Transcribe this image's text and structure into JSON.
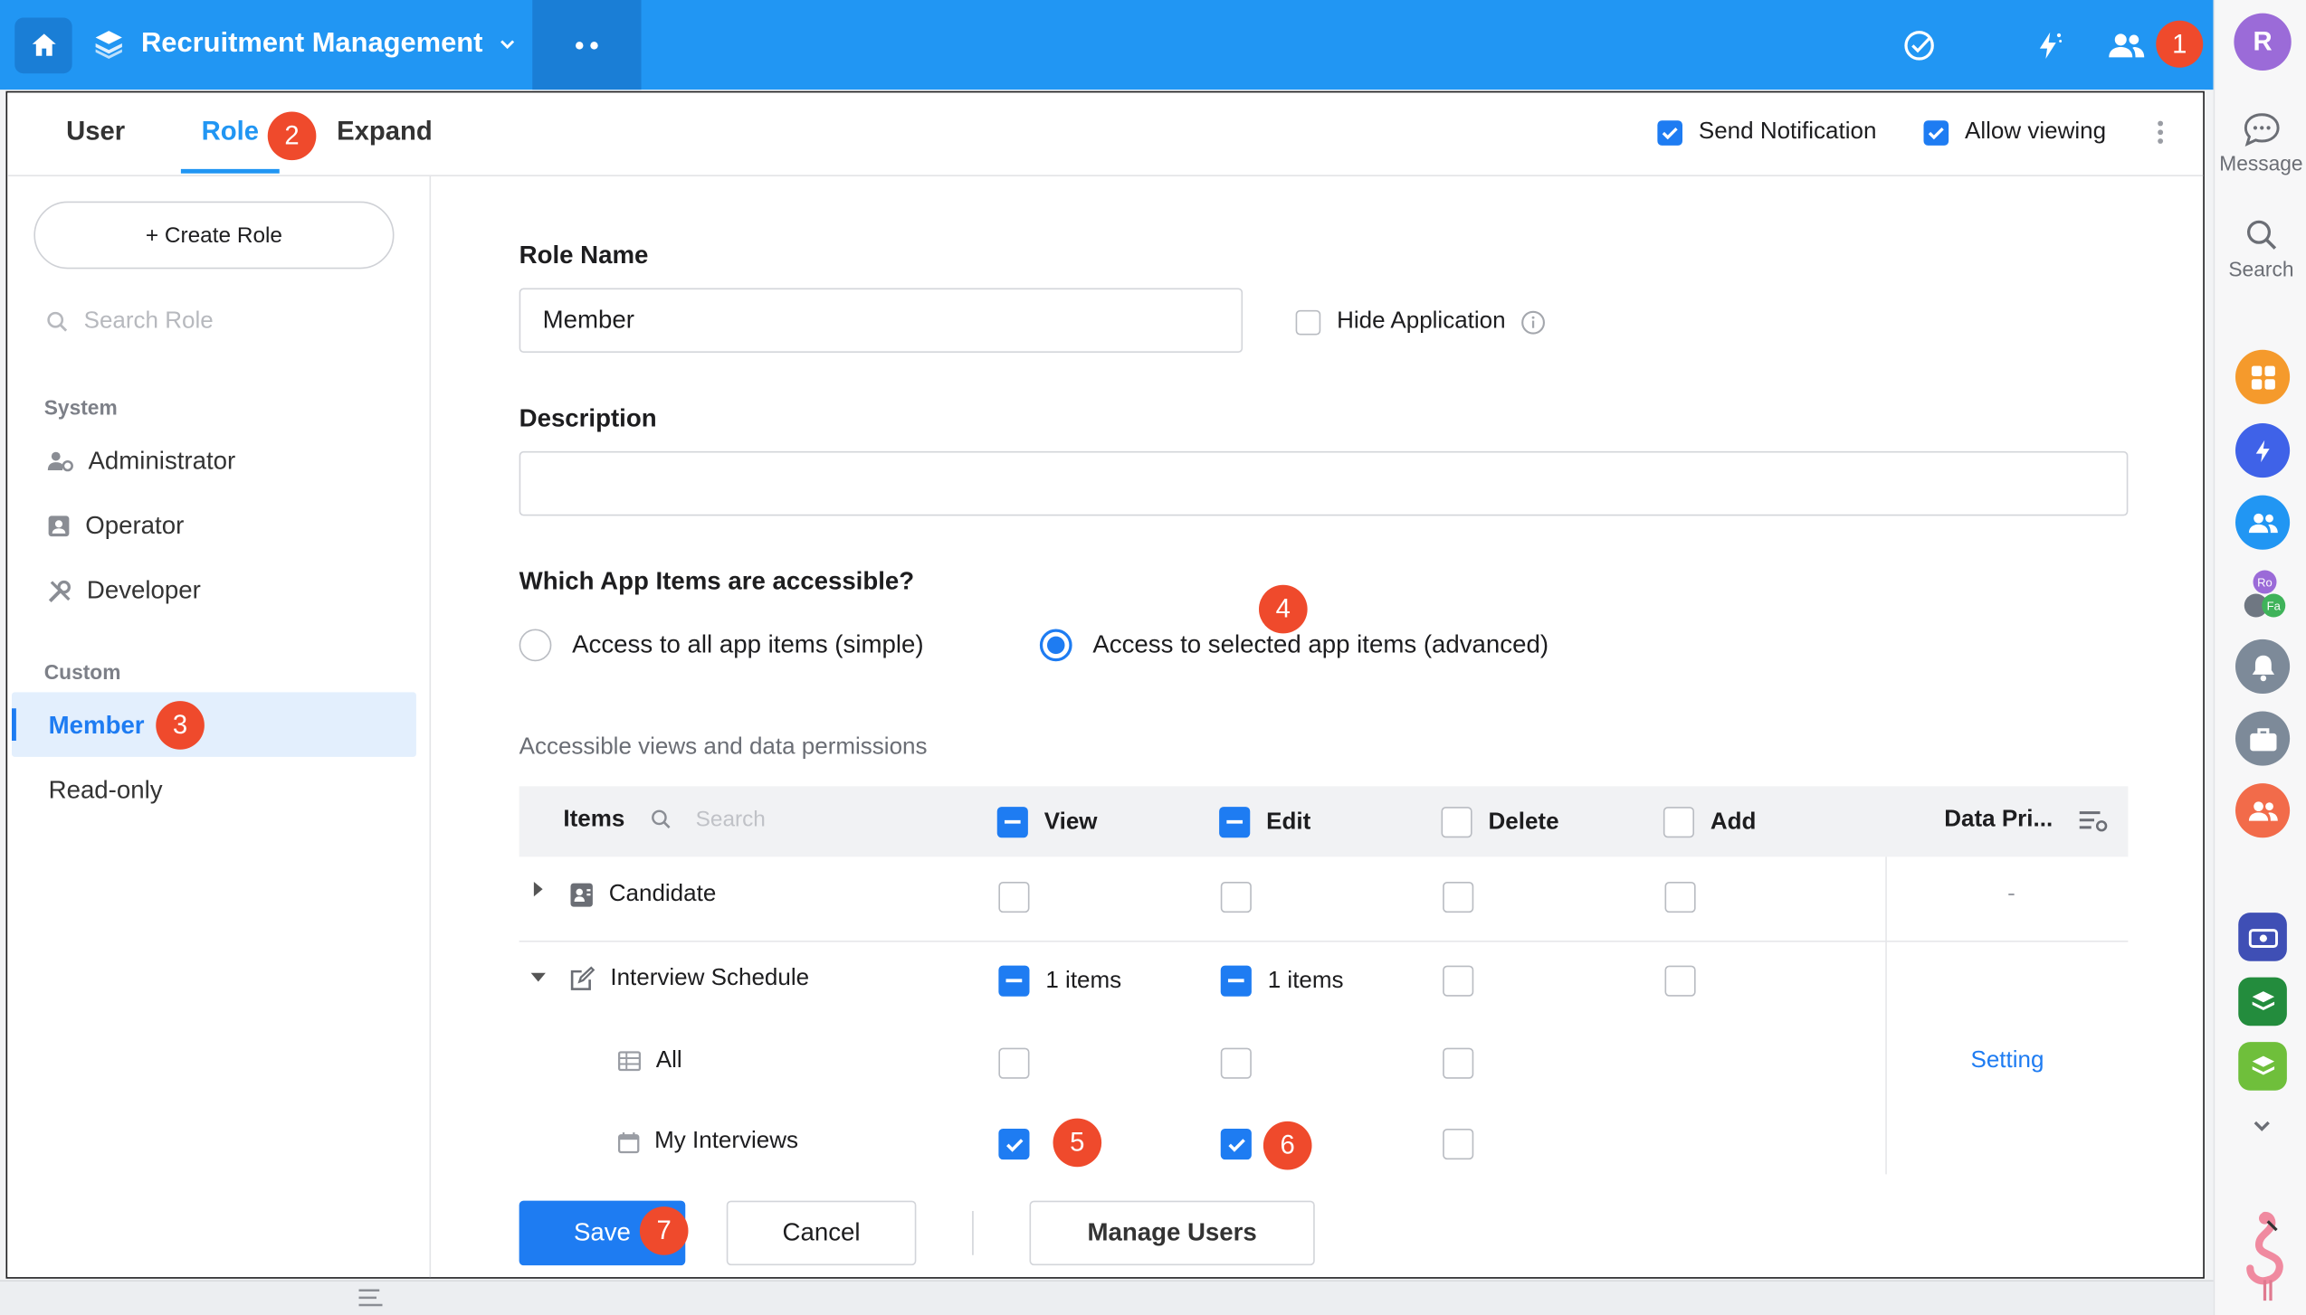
{
  "topbar": {
    "app_name": "Recruitment Management",
    "notification_badge": "1",
    "icons": [
      "home-icon",
      "app-stack-icon",
      "chevron-down-icon",
      "more-dots-icon",
      "task-check-icon",
      "magic-bolt-icon",
      "users-icon"
    ]
  },
  "rail": {
    "avatar_letter": "R",
    "message_label": "Message",
    "search_label": "Search",
    "mini_avatars": [
      "Ro",
      "Fa"
    ]
  },
  "tabs": {
    "user": "User",
    "role": "Role",
    "expand": "Expand",
    "role_badge": "2"
  },
  "header_options": {
    "send_notification": "Send Notification",
    "allow_viewing": "Allow viewing"
  },
  "left": {
    "create_role": "+ Create Role",
    "search_placeholder": "Search Role",
    "system_label": "System",
    "system_roles": [
      "Administrator",
      "Operator",
      "Developer"
    ],
    "custom_label": "Custom",
    "active_role": "Member",
    "active_badge": "3",
    "other_role": "Read-only"
  },
  "form": {
    "role_name_label": "Role Name",
    "role_name_value": "Member",
    "hide_application": "Hide Application",
    "description_label": "Description",
    "description_value": "",
    "access_question": "Which App Items are accessible?",
    "access_simple": "Access to all app items (simple)",
    "access_advanced": "Access to selected app items (advanced)",
    "access_badge": "4",
    "permissions_title": "Accessible views and data permissions"
  },
  "table": {
    "columns": {
      "items": "Items",
      "search_placeholder": "Search",
      "view": "View",
      "edit": "Edit",
      "delete": "Delete",
      "add": "Add",
      "data_privilege": "Data Pri..."
    },
    "rows": {
      "candidate": {
        "label": "Candidate",
        "data_privilege": "-"
      },
      "interview": {
        "label": "Interview Schedule",
        "view_count": "1 items",
        "edit_count": "1 items"
      },
      "all": {
        "label": "All",
        "data_privilege": "Setting"
      },
      "my_interviews": {
        "label": "My Interviews",
        "view_badge": "5",
        "edit_badge": "6"
      }
    }
  },
  "footer": {
    "save": "Save",
    "save_badge": "7",
    "cancel": "Cancel",
    "manage_users": "Manage Users"
  },
  "colors": {
    "brand_blue": "#2196f3",
    "accent_blue": "#1e7cf2",
    "badge_red": "#ef4a2c"
  }
}
